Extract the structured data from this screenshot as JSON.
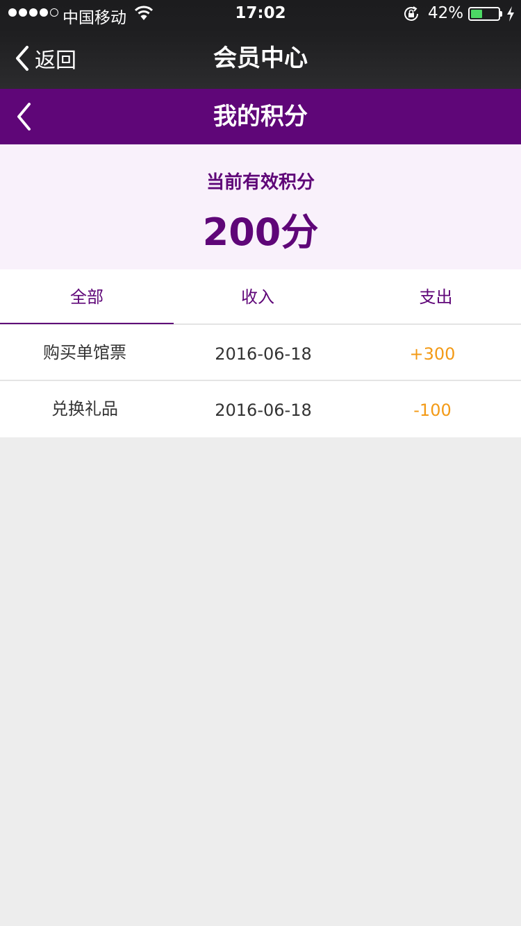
{
  "status_bar": {
    "carrier": "中国移动",
    "time": "17:02",
    "battery_percent": "42%",
    "battery_level": 0.42,
    "signal_bars": 4,
    "signal_total": 5
  },
  "nav": {
    "back_label": "返回",
    "title": "会员中心"
  },
  "header": {
    "title": "我的积分"
  },
  "summary": {
    "label": "当前有效积分",
    "value": "200分"
  },
  "tabs": [
    {
      "label": "全部",
      "active": true
    },
    {
      "label": "收入",
      "active": false
    },
    {
      "label": "支出",
      "active": false
    }
  ],
  "records": [
    {
      "name": "购买单馆票",
      "date": "2016-06-18",
      "amount": "+300"
    },
    {
      "name": "兑换礼品",
      "date": "2016-06-18",
      "amount": "-100"
    }
  ],
  "colors": {
    "brand_purple": "#5f0678",
    "amount_orange": "#f39a16",
    "summary_bg": "#f9f1fb",
    "page_bg": "#ededed"
  },
  "icons": {
    "nav_back": "chevron-left-icon",
    "header_back": "chevron-left-icon",
    "wifi": "wifi-icon",
    "rotation_lock": "rotation-lock-icon",
    "charging": "charging-bolt-icon"
  }
}
